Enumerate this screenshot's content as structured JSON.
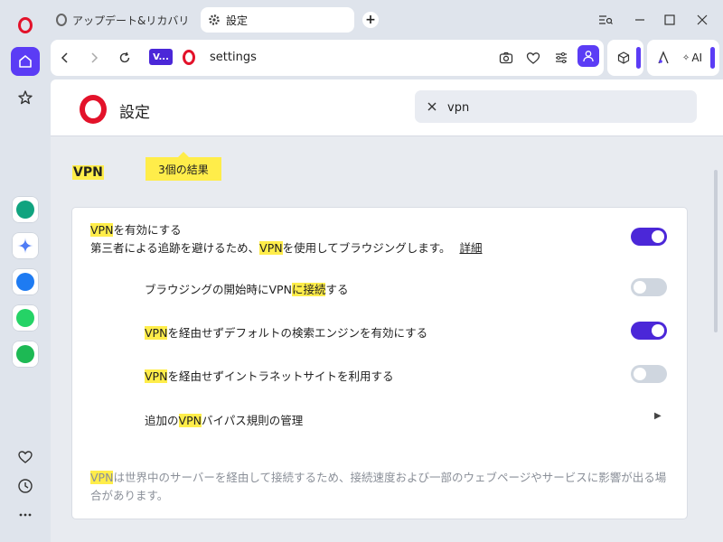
{
  "tabs": [
    {
      "label": "アップデート&リカバリ"
    },
    {
      "label": "設定"
    }
  ],
  "address": {
    "badge": "V...",
    "url": "settings"
  },
  "ext": {
    "ai_label": "AI"
  },
  "settings": {
    "title": "設定",
    "search_value": "vpn",
    "results_label": "3個の結果",
    "section_title": "VPN"
  },
  "vpn": {
    "enable": {
      "hl": "VPN",
      "rest": "を有効にする",
      "desc_pre": "第三者による追跡を避けるため、",
      "desc_hl": "VPN",
      "desc_post": "を使用してブラウジングします。",
      "link": "詳細",
      "toggle": true
    },
    "autoconnect": {
      "pre": "ブラウジングの開始時にVPN",
      "hl": "に接続",
      "post": "する",
      "toggle": false
    },
    "bypass_search": {
      "hl": "VPN",
      "rest": "を経由せずデフォルトの検索エンジンを有効にする",
      "toggle": true
    },
    "bypass_intranet": {
      "hl": "VPN",
      "rest": "を経由せずイントラネットサイトを利用する",
      "toggle": false
    },
    "bypass_rules": {
      "pre": "追加の",
      "hl": "VPN",
      "post": "バイパス規則の管理"
    },
    "note": {
      "hl": "VPN",
      "rest": "は世界中のサーバーを経由して接続するため、接続速度および一部のウェブページやサービスに影響が出る場合があります。"
    }
  },
  "colors": {
    "accent": "#4b27d8",
    "opera_red": "#e3122a",
    "highlight": "#ffed4a"
  },
  "icons": {
    "sidebar": [
      "opera-logo-icon",
      "home-icon",
      "star-icon",
      "chatgpt-icon",
      "gemini-icon",
      "messenger-icon",
      "whatsapp-icon",
      "spotify-icon",
      "heart-icon",
      "history-icon",
      "more-icon"
    ],
    "toolbar": [
      "back-icon",
      "forward-icon",
      "reload-icon",
      "camera-icon",
      "heart-icon",
      "easy-setup-icon",
      "account-icon",
      "cube-icon",
      "aria-icon"
    ]
  }
}
